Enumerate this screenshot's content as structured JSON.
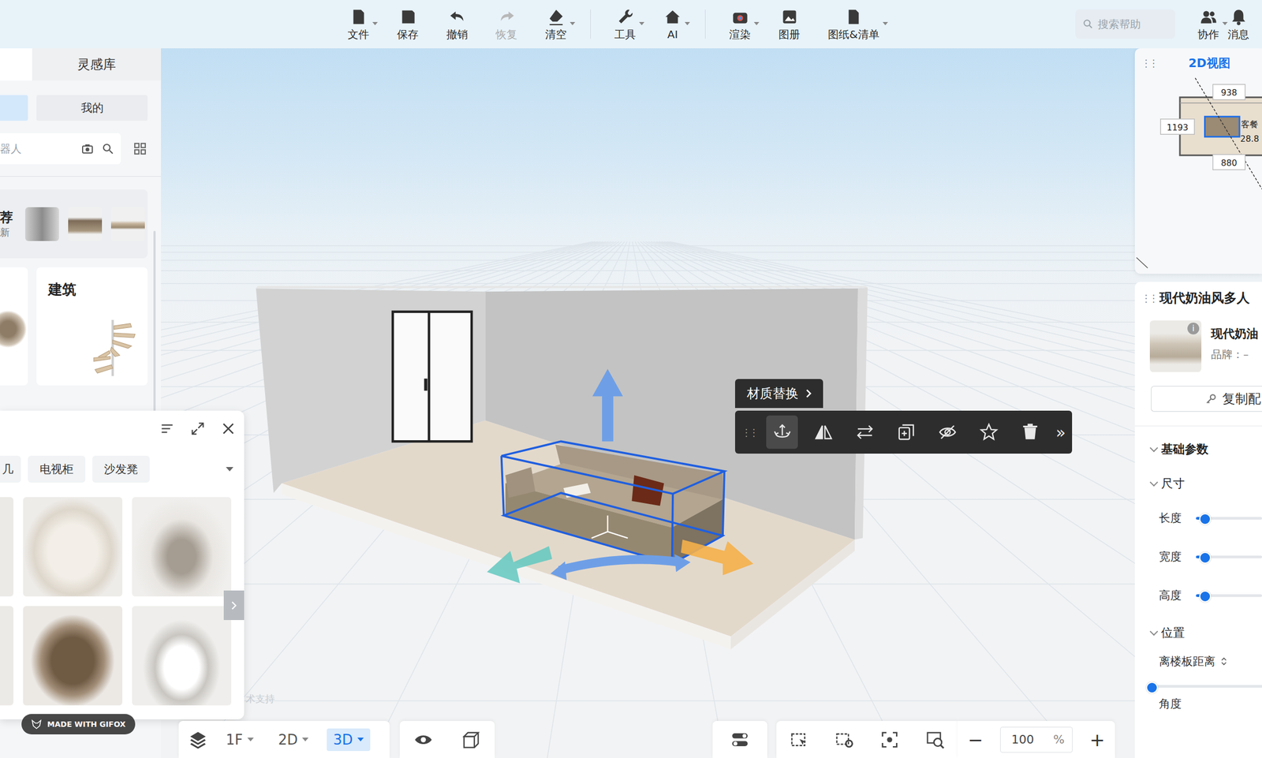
{
  "toolbar": {
    "items": [
      {
        "label": "文件",
        "dropdown": true,
        "disabled": false
      },
      {
        "label": "保存",
        "dropdown": false,
        "disabled": false
      },
      {
        "label": "撤销",
        "dropdown": false,
        "disabled": false
      },
      {
        "label": "恢复",
        "dropdown": false,
        "disabled": true
      },
      {
        "label": "清空",
        "dropdown": true,
        "disabled": false
      },
      {
        "label": "工具",
        "dropdown": true,
        "disabled": false
      },
      {
        "label": "AI",
        "dropdown": true,
        "disabled": false
      },
      {
        "label": "渲染",
        "dropdown": true,
        "disabled": false
      },
      {
        "label": "图册",
        "dropdown": false,
        "disabled": false
      },
      {
        "label": "图纸&清单",
        "dropdown": true,
        "disabled": false
      }
    ],
    "search": {
      "placeholder": "搜索帮助"
    },
    "right": [
      {
        "label": "协作",
        "dropdown": true
      },
      {
        "label": "消息",
        "dropdown": false
      }
    ]
  },
  "library": {
    "tabs": [
      {
        "label": "",
        "selected": true
      },
      {
        "label": "灵感库",
        "selected": false
      }
    ],
    "subtabs": [
      {
        "label": "",
        "selected": true
      },
      {
        "label": "我的",
        "selected": false
      }
    ],
    "search": {
      "placeholder": "器人"
    },
    "featured": {
      "title": "荐",
      "subtitle": "新"
    },
    "categories": [
      {
        "label": "建筑"
      }
    ]
  },
  "products": {
    "tags": [
      "几",
      "电视柜",
      "沙发凳"
    ]
  },
  "badge": "MADE WITH GIFOX",
  "watermark": "术支持",
  "object_toolbar": {
    "chip": "材质替换",
    "tools": [
      {
        "selected": true
      },
      {
        "selected": false
      },
      {
        "selected": false
      },
      {
        "selected": false
      },
      {
        "selected": false
      },
      {
        "selected": false
      },
      {
        "selected": false
      }
    ],
    "more": "»"
  },
  "minimap": {
    "title": "2D视图",
    "dims": [
      "938",
      "1193",
      "880"
    ],
    "room": "客餐",
    "area": "28.8"
  },
  "properties": {
    "title": "现代奶油风多人",
    "product": {
      "name": "现代奶油",
      "brand": "品牌：–",
      "info": "i"
    },
    "copy_button": "复制配",
    "basic": "基础参数",
    "size": {
      "title": "尺寸",
      "sliders": [
        {
          "label": "长度",
          "level": 0.12
        },
        {
          "label": "宽度",
          "level": 0.12
        },
        {
          "label": "高度",
          "level": 0.12
        }
      ]
    },
    "position": {
      "title": "位置",
      "field": "离楼板距离",
      "level": 0
    },
    "angle": "角度"
  },
  "bottom": {
    "floor": "1F",
    "views": [
      {
        "label": "2D",
        "selected": false
      },
      {
        "label": "3D",
        "selected": true
      }
    ],
    "minus": "−",
    "zoom": "100",
    "unit": "%",
    "plus": "+"
  }
}
